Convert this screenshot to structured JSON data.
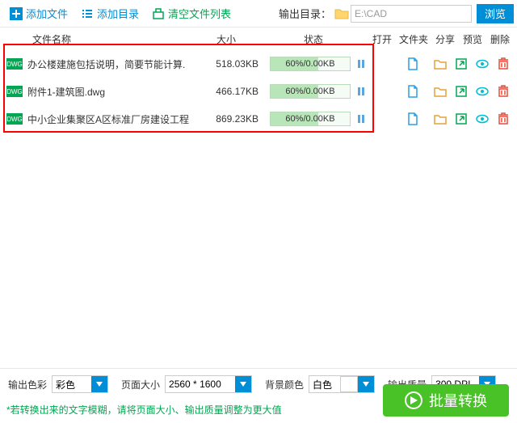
{
  "toolbar": {
    "add_file": "添加文件",
    "add_dir": "添加目录",
    "clear_list": "清空文件列表",
    "output_dir_label": "输出目录：",
    "output_dir_value": "E:\\CAD",
    "browse": "浏览"
  },
  "headers": {
    "name": "文件名称",
    "size": "大小",
    "state": "状态",
    "open": "打开",
    "folder": "文件夹",
    "share": "分享",
    "preview": "预览",
    "delete": "删除"
  },
  "rows": [
    {
      "badge": "DWG",
      "name": "办公楼建施包括说明，简要节能计算.",
      "size": "518.03KB",
      "progress_pct": 60,
      "progress_text": "60%/0.00KB"
    },
    {
      "badge": "DWG",
      "name": "附件1-建筑图.dwg",
      "size": "466.17KB",
      "progress_pct": 60,
      "progress_text": "60%/0.00KB"
    },
    {
      "badge": "DWG",
      "name": "中小企业集聚区A区标准厂房建设工程",
      "size": "869.23KB",
      "progress_pct": 60,
      "progress_text": "60%/0.00KB"
    }
  ],
  "settings": {
    "color_label": "输出色彩",
    "color_value": "彩色",
    "pagesize_label": "页面大小",
    "pagesize_value": "2560 * 1600",
    "bgcolor_label": "背景颜色",
    "bgcolor_value": "白色",
    "quality_label": "输出质量",
    "quality_value": "300 DPI"
  },
  "hint": "*若转换出来的文字模糊，请将页面大小、输出质量调整为更大值",
  "convert": "批量转换"
}
